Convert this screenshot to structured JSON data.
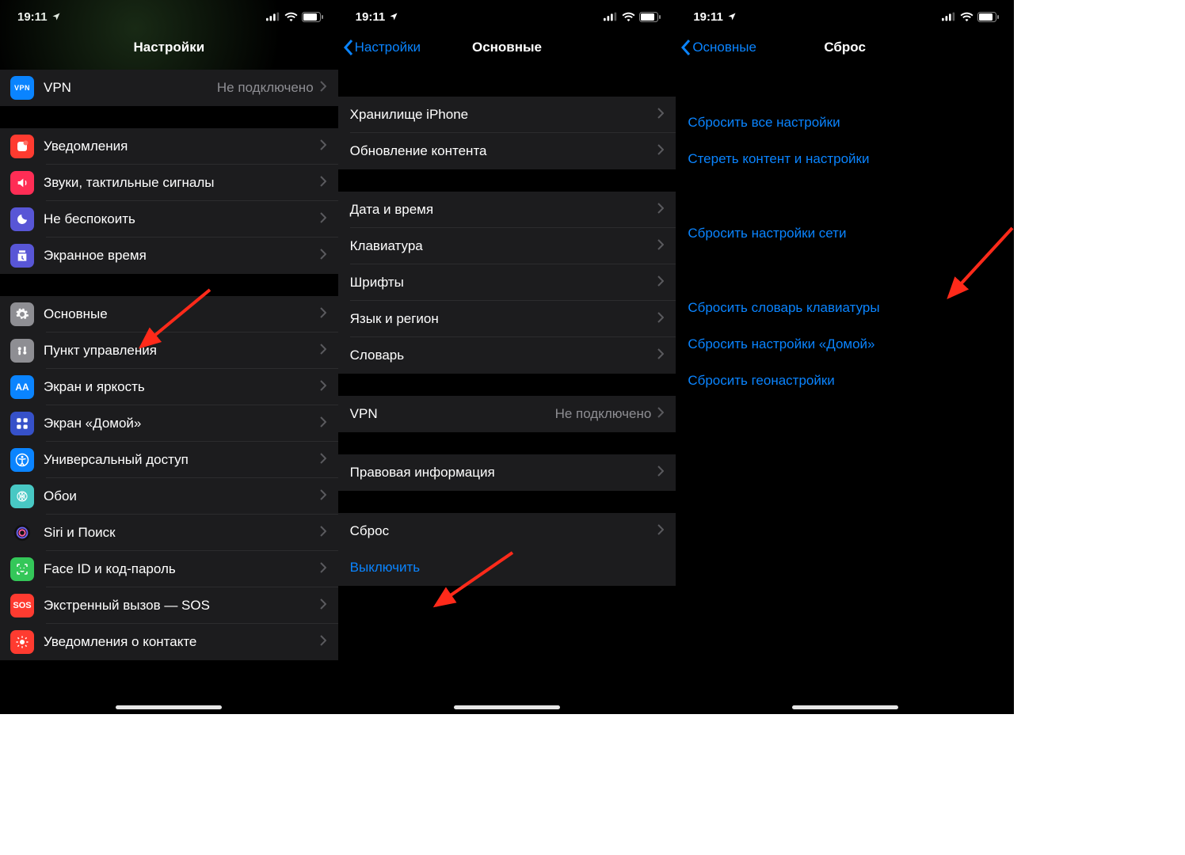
{
  "status": {
    "time": "19:11"
  },
  "screen1": {
    "title": "Настройки",
    "vpn_group": {
      "label": "VPN",
      "detail": "Не подключено"
    },
    "rows_a": [
      {
        "icon": "notifications",
        "label": "Уведомления"
      },
      {
        "icon": "sounds",
        "label": "Звуки, тактильные сигналы"
      },
      {
        "icon": "dnd",
        "label": "Не беспокоить"
      },
      {
        "icon": "screentime",
        "label": "Экранное время"
      }
    ],
    "rows_b": [
      {
        "icon": "general",
        "label": "Основные"
      },
      {
        "icon": "controlcenter",
        "label": "Пункт управления"
      },
      {
        "icon": "display",
        "label": "Экран и яркость"
      },
      {
        "icon": "homescreen",
        "label": "Экран «Домой»"
      },
      {
        "icon": "accessibility",
        "label": "Универсальный доступ"
      },
      {
        "icon": "wallpaper",
        "label": "Обои"
      },
      {
        "icon": "siri",
        "label": "Siri и Поиск"
      },
      {
        "icon": "faceid",
        "label": "Face ID и код-пароль"
      },
      {
        "icon": "sos",
        "label": "Экстренный вызов — SOS"
      },
      {
        "icon": "exposure",
        "label": "Уведомления о контакте"
      }
    ]
  },
  "screen2": {
    "back": "Настройки",
    "title": "Основные",
    "rows_a": [
      {
        "label": "Хранилище iPhone"
      },
      {
        "label": "Обновление контента"
      }
    ],
    "rows_b": [
      {
        "label": "Дата и время"
      },
      {
        "label": "Клавиатура"
      },
      {
        "label": "Шрифты"
      },
      {
        "label": "Язык и регион"
      },
      {
        "label": "Словарь"
      }
    ],
    "rows_c": [
      {
        "label": "VPN",
        "detail": "Не подключено"
      }
    ],
    "rows_d": [
      {
        "label": "Правовая информация"
      }
    ],
    "rows_e": [
      {
        "label": "Сброс"
      }
    ],
    "shutdown": "Выключить"
  },
  "screen3": {
    "back": "Основные",
    "title": "Сброс",
    "rows_a": [
      {
        "label": "Сбросить все настройки"
      },
      {
        "label": "Стереть контент и настройки"
      }
    ],
    "rows_b": [
      {
        "label": "Сбросить настройки сети"
      }
    ],
    "rows_c": [
      {
        "label": "Сбросить словарь клавиатуры"
      },
      {
        "label": "Сбросить настройки «Домой»"
      },
      {
        "label": "Сбросить геонастройки"
      }
    ]
  },
  "icons": {
    "notifications": {
      "bg": "#ff3b30"
    },
    "sounds": {
      "bg": "#ff2d55"
    },
    "dnd": {
      "bg": "#5856d6"
    },
    "screentime": {
      "bg": "#5856d6"
    },
    "general": {
      "bg": "#8e8e93"
    },
    "controlcenter": {
      "bg": "#8e8e93"
    },
    "display": {
      "bg": "#0a84ff"
    },
    "homescreen": {
      "bg": "#3651c9"
    },
    "accessibility": {
      "bg": "#0a84ff"
    },
    "wallpaper": {
      "bg": "#48c8c4"
    },
    "siri": {
      "bg": "#1c1c1e"
    },
    "faceid": {
      "bg": "#34c759"
    },
    "sos": {
      "bg": "#ff3b30"
    },
    "exposure": {
      "bg": "#ff3b30"
    },
    "vpn": {
      "bg": "#0a84ff"
    }
  }
}
